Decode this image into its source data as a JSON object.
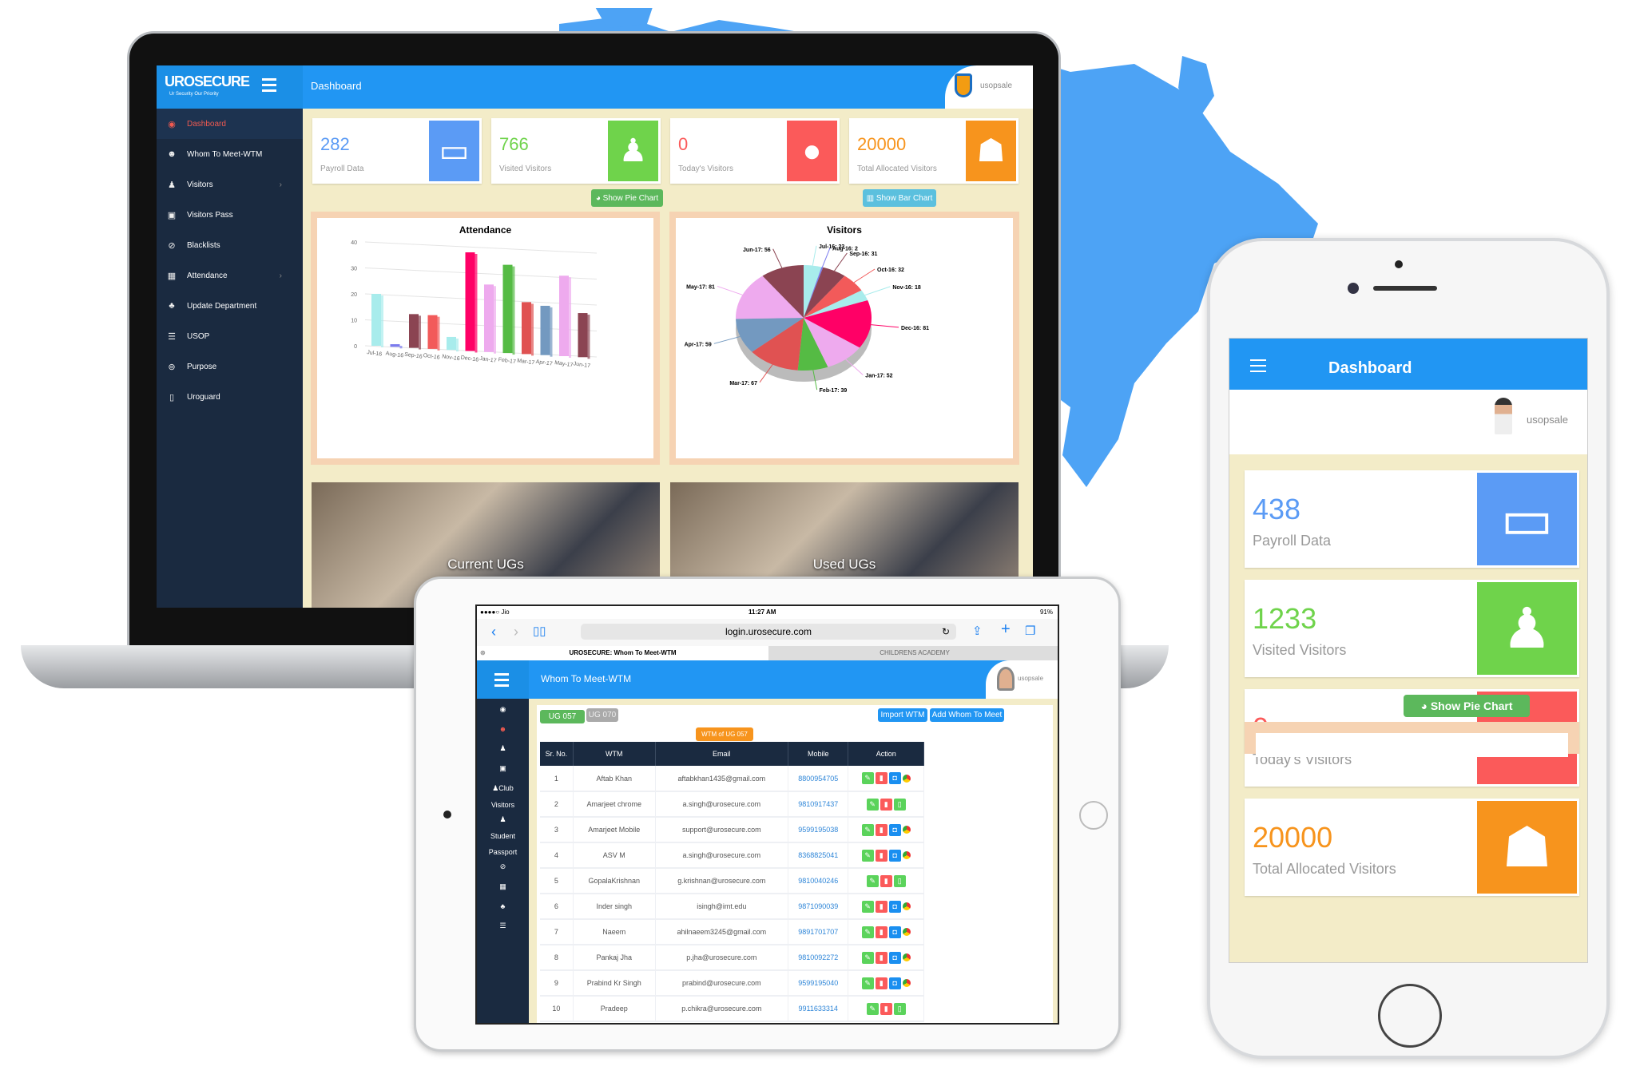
{
  "colors": {
    "primary": "#2196f3",
    "sidebar": "#1a2a40",
    "blue": "#5b9bf5",
    "green": "#6fd34b",
    "red": "#fb5a5a",
    "orange": "#f7941d",
    "map": "#4da3f5"
  },
  "laptop": {
    "brand": {
      "name": "UROSECURE",
      "tagline": "Ur Security Our Priority"
    },
    "header": {
      "title": "Dashboard",
      "user": "usopsale"
    },
    "sidebar": [
      {
        "label": "Dashboard",
        "icon": "dashboard-icon",
        "active": true
      },
      {
        "label": "Whom To Meet-WTM",
        "icon": "users-icon"
      },
      {
        "label": "Visitors",
        "icon": "person-icon",
        "chevron": true
      },
      {
        "label": "Visitors Pass",
        "icon": "calendar-icon"
      },
      {
        "label": "Blacklists",
        "icon": "ban-icon"
      },
      {
        "label": "Attendance",
        "icon": "calendar-grid-icon",
        "chevron": true
      },
      {
        "label": "Update Department",
        "icon": "sitemap-icon"
      },
      {
        "label": "USOP",
        "icon": "server-icon"
      },
      {
        "label": "Purpose",
        "icon": "compass-icon"
      },
      {
        "label": "Uroguard",
        "icon": "tablet-icon"
      }
    ],
    "cards": [
      {
        "value": "282",
        "label": "Payroll Data",
        "icon": "wallet-icon",
        "color": "#5b9bf5"
      },
      {
        "value": "766",
        "label": "Visited Visitors",
        "icon": "male-icon",
        "color": "#6fd34b"
      },
      {
        "value": "0",
        "label": "Today's Visitors",
        "icon": "user-icon",
        "color": "#fb5a5a"
      },
      {
        "value": "20000",
        "label": "Total Allocated Visitors",
        "icon": "group-icon",
        "color": "#f7941d"
      }
    ],
    "buttons": {
      "pie": "Show Pie Chart",
      "bar": "Show Bar Chart"
    },
    "tiles": [
      "Current UGs",
      "Used UGs"
    ]
  },
  "chart_data": [
    {
      "type": "bar",
      "title": "Attendance",
      "categories": [
        "Jul-16",
        "Aug-16",
        "Sep-16",
        "Oct-16",
        "Nov-16",
        "Dec-16",
        "Jan-17",
        "Feb-17",
        "Mar-17",
        "Apr-17",
        "May-17",
        "Jun-17"
      ],
      "values": [
        20,
        1,
        13,
        13,
        5,
        38,
        26,
        34,
        20,
        19,
        31,
        17
      ],
      "ylim": [
        0,
        40
      ],
      "yticks": [
        0,
        10,
        20,
        30,
        40
      ],
      "grid": true,
      "colors": [
        "#a8ecec",
        "#7b7bee",
        "#8b4452",
        "#f25a5a",
        "#a8ecec",
        "#ff0066",
        "#eeaaee",
        "#55bb44",
        "#e05252",
        "#7399c0",
        "#eeaaee",
        "#8b4452"
      ]
    },
    {
      "type": "pie",
      "title": "Visitors",
      "categories": [
        "Jul-16",
        "Aug-16",
        "Sep-16",
        "Oct-16",
        "Nov-16",
        "Dec-16",
        "Jan-17",
        "Feb-17",
        "Mar-17",
        "Apr-17",
        "May-17",
        "Jun-17"
      ],
      "values": [
        23,
        2,
        31,
        32,
        18,
        81,
        52,
        39,
        67,
        59,
        81,
        56
      ],
      "colors": [
        "#a8ecec",
        "#7b7bee",
        "#8b4452",
        "#f25a5a",
        "#a8ecec",
        "#ff0066",
        "#eeaaee",
        "#55bb44",
        "#e05252",
        "#7399c0",
        "#eeaaee",
        "#8b4452"
      ]
    }
  ],
  "tablet": {
    "status": {
      "carrier": "●●●●○ Jio",
      "time": "11:27 AM",
      "battery": "91%"
    },
    "url": "login.urosecure.com",
    "tabs": [
      "UROSECURE: Whom To Meet-WTM",
      "CHILDRENS ACADEMY"
    ],
    "header": {
      "title": "Whom To Meet-WTM",
      "user": "usopsale"
    },
    "sidebar": [
      "Club",
      "Visitors",
      "Student",
      "Passport"
    ],
    "ug_tabs": [
      "UG 057",
      "UG 070"
    ],
    "buttons": {
      "import": "Import WTM",
      "add": "Add Whom To Meet"
    },
    "badge": "WTM of UG 057",
    "columns": [
      "Sr. No.",
      "WTM",
      "Email",
      "Mobile",
      "Action"
    ],
    "rows": [
      [
        "1",
        "Aftab Khan",
        "aftabkhan1435@gmail.com",
        "8800954705",
        "android"
      ],
      [
        "2",
        "Amarjeet chrome",
        "a.singh@urosecure.com",
        "9810917437",
        "device"
      ],
      [
        "3",
        "Amarjeet Mobile",
        "support@urosecure.com",
        "9599195038",
        "android"
      ],
      [
        "4",
        "ASV M",
        "a.singh@urosecure.com",
        "8368825041",
        "android"
      ],
      [
        "5",
        "GopalaKrishnan",
        "g.krishnan@urosecure.com",
        "9810040246",
        "device"
      ],
      [
        "6",
        "Inder singh",
        "isingh@imt.edu",
        "9871090039",
        "android"
      ],
      [
        "7",
        "Naeem",
        "ahilnaeem3245@gmail.com",
        "9891701707",
        "android"
      ],
      [
        "8",
        "Pankaj Jha",
        "p.jha@urosecure.com",
        "9810092272",
        "android"
      ],
      [
        "9",
        "Prabind Kr Singh",
        "prabind@urosecure.com",
        "9599195040",
        "android"
      ],
      [
        "10",
        "Pradeep",
        "p.chikra@urosecure.com",
        "9911633314",
        "device"
      ]
    ]
  },
  "phone": {
    "header": {
      "title": "Dashboard",
      "user": "usopsale"
    },
    "cards": [
      {
        "value": "438",
        "label": "Payroll Data",
        "icon": "wallet-icon",
        "color": "#5b9bf5"
      },
      {
        "value": "1233",
        "label": "Visited Visitors",
        "icon": "male-icon",
        "color": "#6fd34b"
      },
      {
        "value": "0",
        "label": "Today's Visitors",
        "icon": "user-icon",
        "color": "#fb5a5a"
      },
      {
        "value": "20000",
        "label": "Total Allocated Visitors",
        "icon": "group-icon",
        "color": "#f7941d"
      }
    ],
    "button": "Show Pie Chart"
  }
}
